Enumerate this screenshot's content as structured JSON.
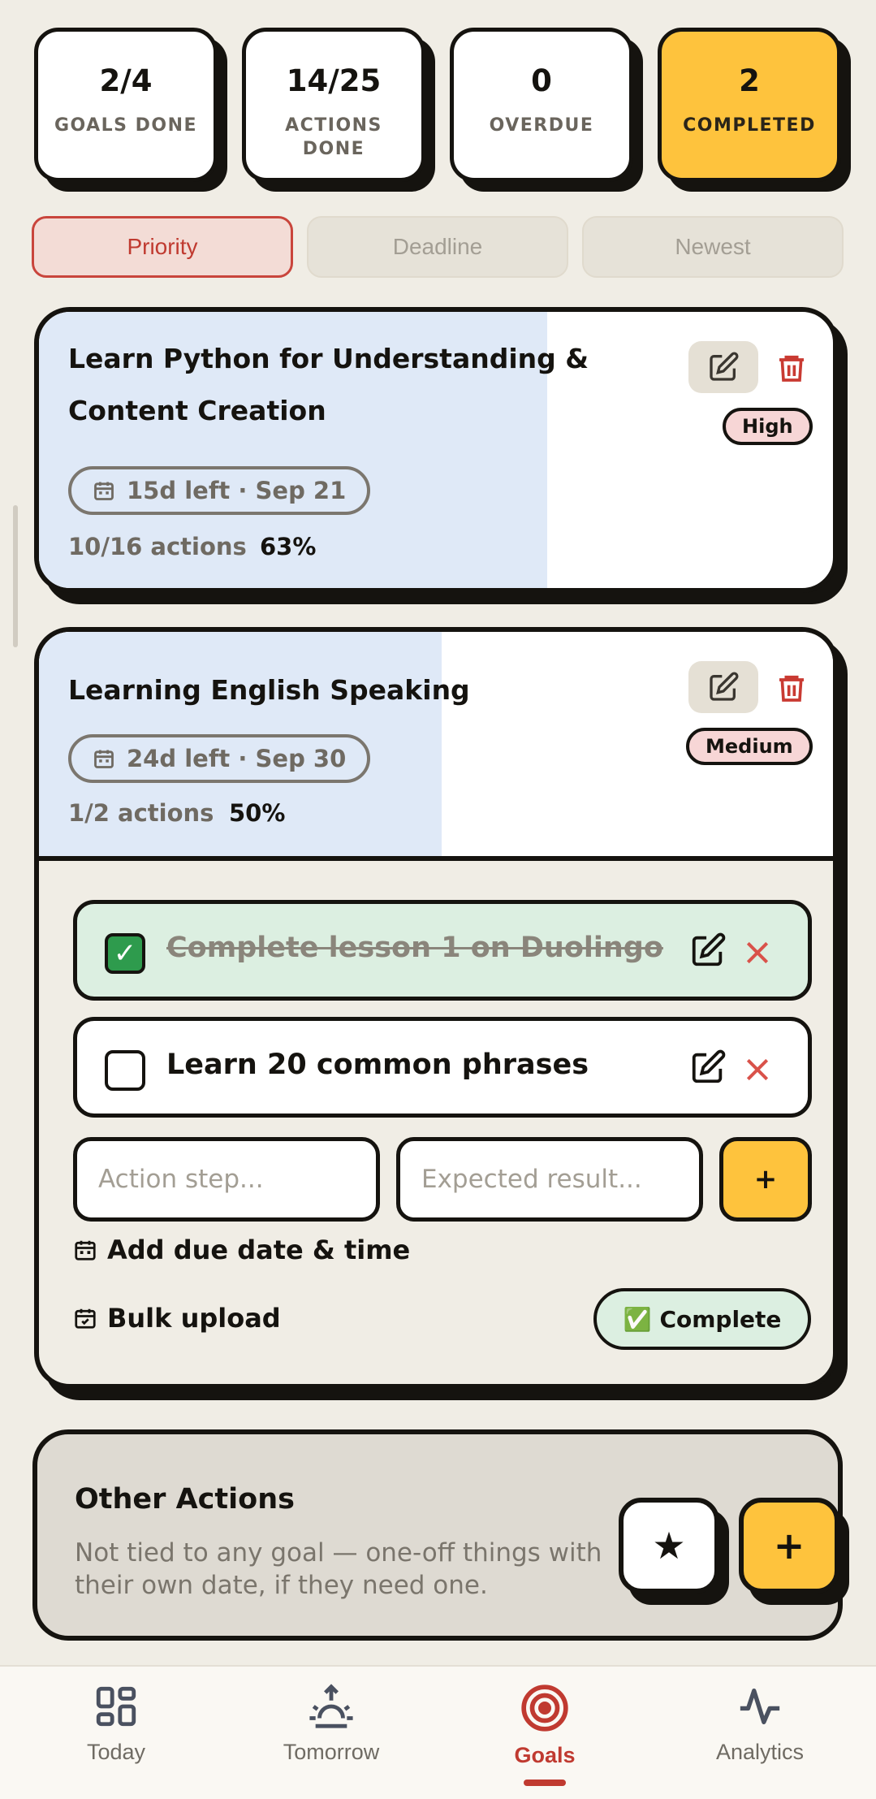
{
  "stats": [
    {
      "value": "2/4",
      "label": "GOALS DONE"
    },
    {
      "value": "14/25",
      "label": "ACTIONS DONE"
    },
    {
      "value": "0",
      "label": "OVERDUE"
    },
    {
      "value": "2",
      "label": "COMPLETED"
    }
  ],
  "sort_tabs": [
    "Priority",
    "Deadline",
    "Newest"
  ],
  "sort_active": "Priority",
  "goals": [
    {
      "title_line1": "Learn Python for Understanding &",
      "title_line2": "Content Creation",
      "deadline": "15d left · Sep 21",
      "actions": "10/16 actions",
      "percent": "63%",
      "progress": 0.63,
      "priority": "High"
    },
    {
      "title_line1": "Learning English Speaking",
      "deadline": "24d left · Sep 30",
      "actions": "1/2 actions",
      "percent": "50%",
      "progress": 0.5,
      "priority": "Medium",
      "action_items": [
        {
          "text": "Complete lesson 1 on Duolingo",
          "done": true
        },
        {
          "text": "Learn 20 common phrases",
          "done": false
        }
      ],
      "step_placeholder": "Action step...",
      "result_placeholder": "Expected result...",
      "add_label": "+",
      "due_date_label": "Add due date & time",
      "bulk_label": "Bulk upload",
      "complete_label": "Complete",
      "complete_emoji": "✅"
    }
  ],
  "other_actions": {
    "title": "Other Actions",
    "description": "Not tied to any goal — one-off things with their own date, if they need one."
  },
  "fab": {
    "star": "★",
    "plus": "+"
  },
  "nav": [
    {
      "label": "Today",
      "icon": "grid-icon"
    },
    {
      "label": "Tomorrow",
      "icon": "sunrise-icon"
    },
    {
      "label": "Goals",
      "icon": "target-icon",
      "active": true
    },
    {
      "label": "Analytics",
      "icon": "activity-icon"
    }
  ],
  "colors": {
    "accent_yellow": "#fec33d",
    "active_red": "#c03a30",
    "progress_blue": "#dfe9f7",
    "done_green": "#2e9b4d"
  }
}
